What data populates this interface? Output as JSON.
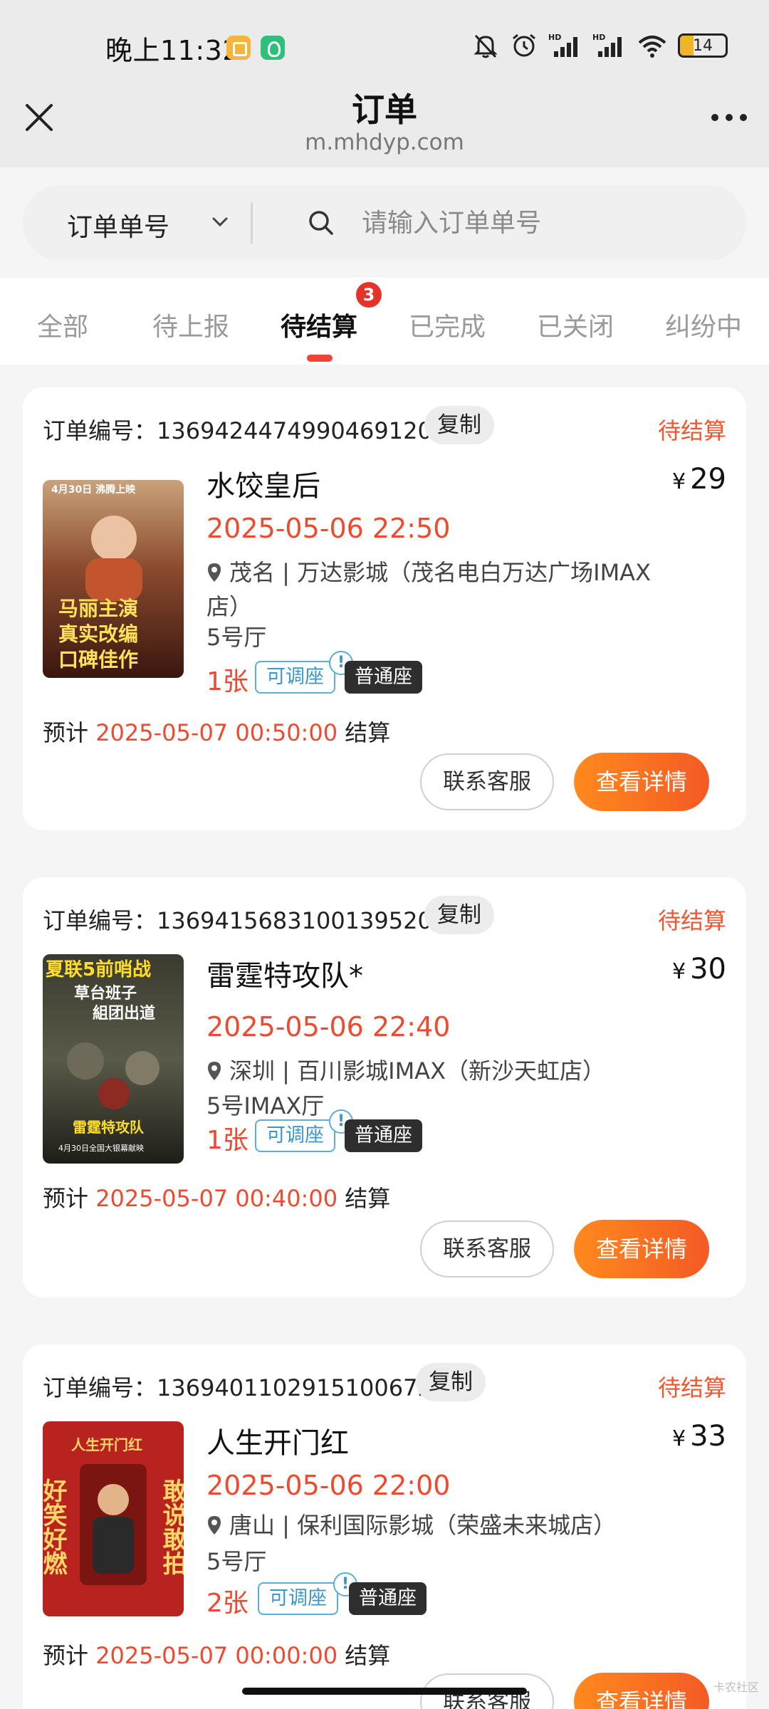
{
  "status_bar": {
    "time": "晚上11:32",
    "battery": "14"
  },
  "header": {
    "title": "订单",
    "url": "m.mhdyp.com"
  },
  "search": {
    "select_label": "订单单号",
    "placeholder": "请输入订单单号"
  },
  "tabs": [
    {
      "label": "全部"
    },
    {
      "label": "待上报"
    },
    {
      "label": "待结算",
      "badge": "3",
      "active": true
    },
    {
      "label": "已完成"
    },
    {
      "label": "已关闭"
    },
    {
      "label": "纠纷中"
    }
  ],
  "orders": [
    {
      "order_no": "订单编号：1369424474990469120",
      "copy_label": "复制",
      "status": "待结算",
      "title": "水饺皇后",
      "currency": "¥",
      "price": "29",
      "showtime": "2025-05-06 22:50",
      "location": "茂名 | 万达影城（茂名电白万达广场IMAX店）",
      "hall": "5号厅",
      "count": "1张",
      "adjust_tag": "可调座",
      "seat_tag": "普通座",
      "settle_prefix": "预计",
      "settle_time": "2025-05-07 00:50:00",
      "settle_suffix": "结算",
      "contact_label": "联系客服",
      "detail_label": "查看详情",
      "poster_lines": [
        "4月30日 沸腾上映",
        "马丽主演",
        "真实改编",
        "口碑佳作"
      ]
    },
    {
      "order_no": "订单编号：1369415683100139520",
      "copy_label": "复制",
      "status": "待结算",
      "title": "雷霆特攻队*",
      "currency": "¥",
      "price": "30",
      "showtime": "2025-05-06 22:40",
      "location": "深圳 | 百川影城IMAX（新沙天虹店）",
      "hall": "5号IMAX厅",
      "count": "1张",
      "adjust_tag": "可调座",
      "seat_tag": "普通座",
      "settle_prefix": "预计",
      "settle_time": "2025-05-07 00:40:00",
      "settle_suffix": "结算",
      "contact_label": "联系客服",
      "detail_label": "查看详情",
      "poster_lines": [
        "夏联5前哨战",
        "草台班子",
        "組团出道",
        "雷霆特攻队",
        "4月30日全国大银幕献映"
      ]
    },
    {
      "order_no": "订单编号：1369401102915100672",
      "copy_label": "复制",
      "status": "待结算",
      "title": "人生开门红",
      "currency": "¥",
      "price": "33",
      "showtime": "2025-05-06 22:00",
      "location": "唐山 | 保利国际影城（荣盛未来城店）",
      "hall": "5号厅",
      "count": "2张",
      "adjust_tag": "可调座",
      "seat_tag": "普通座",
      "settle_prefix": "预计",
      "settle_time": "2025-05-07 00:00:00",
      "settle_suffix": "结算",
      "contact_label": "联系客服",
      "detail_label": "查看详情",
      "poster_lines": [
        "人生开门红",
        "好笑好燃",
        "敢说敢拍"
      ]
    }
  ],
  "watermark": "卡农社区"
}
